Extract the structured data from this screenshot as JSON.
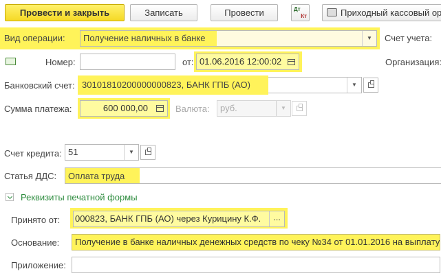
{
  "toolbar": {
    "post_close": "Провести и закрыть",
    "save": "Записать",
    "post": "Провести",
    "dtkt_top": "Дт",
    "dtkt_bottom": "Кт",
    "print_doc": "Приходный кассовый ор"
  },
  "form": {
    "operation_label": "Вид операции:",
    "operation_value": "Получение наличных в банке",
    "account_label": "Счет учета:",
    "number_label": "Номер:",
    "number_value": "",
    "from_label": "от:",
    "date_value": "01.06.2016 12:00:02",
    "org_label": "Организация:",
    "bank_label": "Банковский счет:",
    "bank_value": "30101810200000000823, БАНК ГПБ (АО)",
    "sum_label": "Сумма платежа:",
    "sum_value": "600 000,00",
    "currency_label": "Валюта:",
    "currency_value": "руб.",
    "credit_label": "Счет кредита:",
    "credit_value": "51",
    "dds_label": "Статья ДДС:",
    "dds_value": "Оплата труда"
  },
  "print_section": {
    "title": "Реквизиты печатной формы",
    "received_label": "Принято от:",
    "received_value": "000823, БАНК ГПБ (АО) через Курицину К.Ф.",
    "more": "...",
    "basis_label": "Основание:",
    "basis_value": "Получение в банке наличных денежных средств по чеку №34 от 01.01.2016 на выплату",
    "attachment_label": "Приложение:",
    "attachment_value": ""
  },
  "colors": {
    "highlight": "#fff35a",
    "primary_button": "#f5d926",
    "link": "#2c8b3d"
  }
}
